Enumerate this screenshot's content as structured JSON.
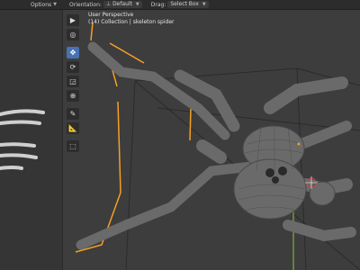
{
  "topbar": {
    "options_label": "Options",
    "orientation_label": "Orientation:",
    "orientation_value": "Default",
    "drag_label": "Drag:",
    "drag_value": "Select Box"
  },
  "viewport": {
    "perspective": "User Perspective",
    "collection": "(14) Collection | skeleton spider"
  },
  "tools": [
    {
      "name": "select-tool",
      "icon": "cursor-arrow"
    },
    {
      "name": "cursor-tool",
      "icon": "3d-cursor"
    },
    {
      "name": "move-tool",
      "icon": "move-arrows",
      "active": true
    },
    {
      "name": "rotate-tool",
      "icon": "rotate"
    },
    {
      "name": "scale-tool",
      "icon": "scale"
    },
    {
      "name": "transform-tool",
      "icon": "transform"
    },
    {
      "name": "annotate-tool",
      "icon": "pencil"
    },
    {
      "name": "measure-tool",
      "icon": "ruler"
    },
    {
      "name": "add-cube-tool",
      "icon": "cube"
    }
  ],
  "colors": {
    "active_tool": "#4772b3",
    "selection_outline": "#f4a024",
    "axis_y": "#8bc34a"
  }
}
